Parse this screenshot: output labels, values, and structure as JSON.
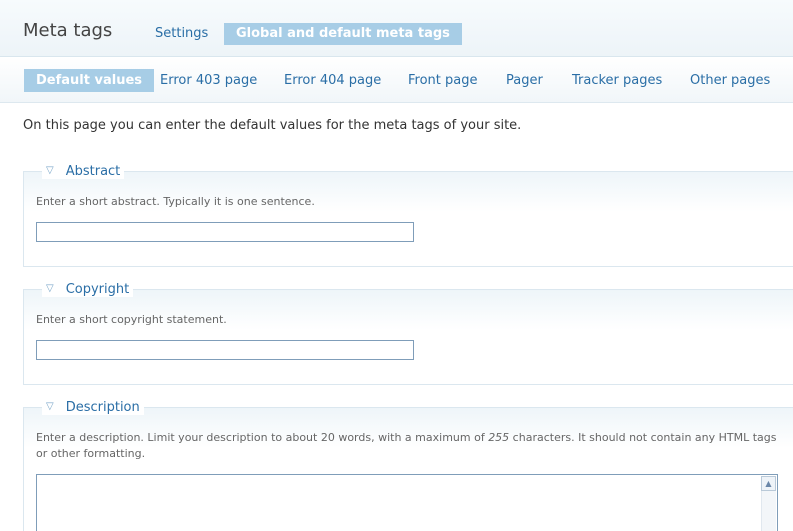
{
  "header": {
    "title": "Meta tags",
    "tabs": [
      {
        "label": "Settings"
      },
      {
        "label": "Global and default meta tags",
        "active": true
      }
    ]
  },
  "subtabs": [
    {
      "label": "Default values",
      "active": true
    },
    {
      "label": "Error 403 page"
    },
    {
      "label": "Error 404 page"
    },
    {
      "label": "Front page"
    },
    {
      "label": "Pager"
    },
    {
      "label": "Tracker pages"
    },
    {
      "label": "Other pages"
    }
  ],
  "intro": "On this page you can enter the default values for the meta tags of your site.",
  "fieldsets": {
    "abstract": {
      "legend": "Abstract",
      "description": "Enter a short abstract. Typically it is one sentence.",
      "value": ""
    },
    "copyright": {
      "legend": "Copyright",
      "description": "Enter a short copyright statement.",
      "value": ""
    },
    "description": {
      "legend": "Description",
      "description_before": "Enter a description. Limit your description to about 20 words, with a maximum of ",
      "description_em": "255",
      "description_after": " characters. It should not contain any HTML tags",
      "description_line2": "or other formatting.",
      "value": ""
    }
  },
  "icons": {
    "collapse": "triangle-down-icon",
    "scroll_up": "scroll-up-arrow-icon"
  }
}
